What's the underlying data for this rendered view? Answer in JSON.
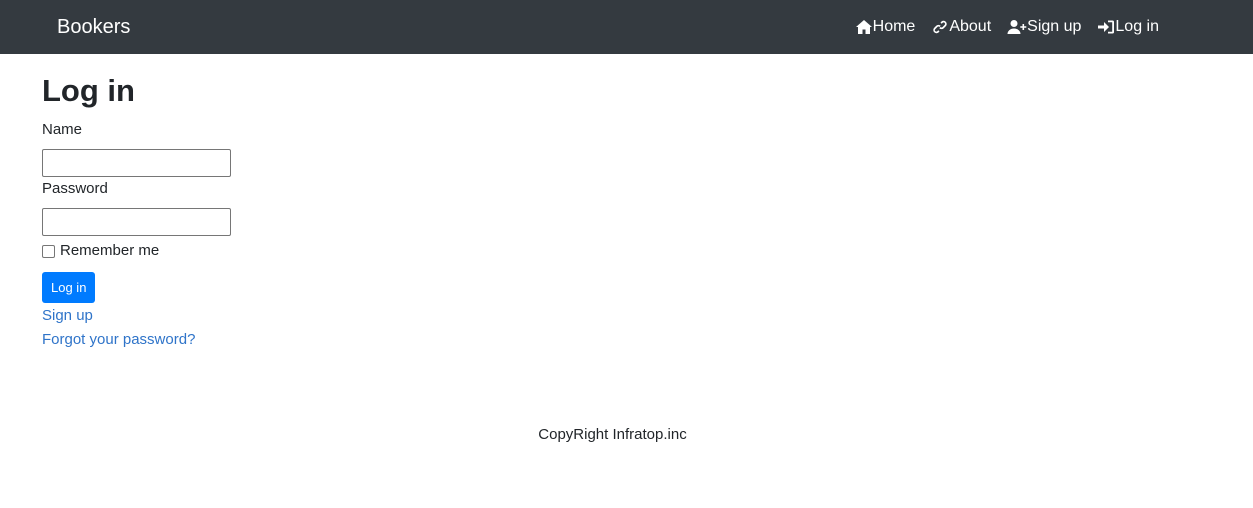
{
  "navbar": {
    "brand": "Bookers",
    "links": [
      {
        "label": "Home",
        "icon": "home-icon"
      },
      {
        "label": "About",
        "icon": "link-icon"
      },
      {
        "label": "Sign up",
        "icon": "user-plus-icon"
      },
      {
        "label": "Log in",
        "icon": "sign-in-icon"
      }
    ]
  },
  "main": {
    "title": "Log in",
    "name_label": "Name",
    "name_value": "",
    "password_label": "Password",
    "password_value": "",
    "remember_label": "Remember me",
    "remember_checked": false,
    "submit_label": "Log in",
    "signup_link": "Sign up",
    "forgot_link": "Forgot your password?"
  },
  "footer": {
    "text": "CopyRight Infratop.inc"
  },
  "colors": {
    "navbar_bg": "#343a40",
    "primary_button": "#007bff",
    "link": "#2f74c9",
    "text": "#212529"
  }
}
